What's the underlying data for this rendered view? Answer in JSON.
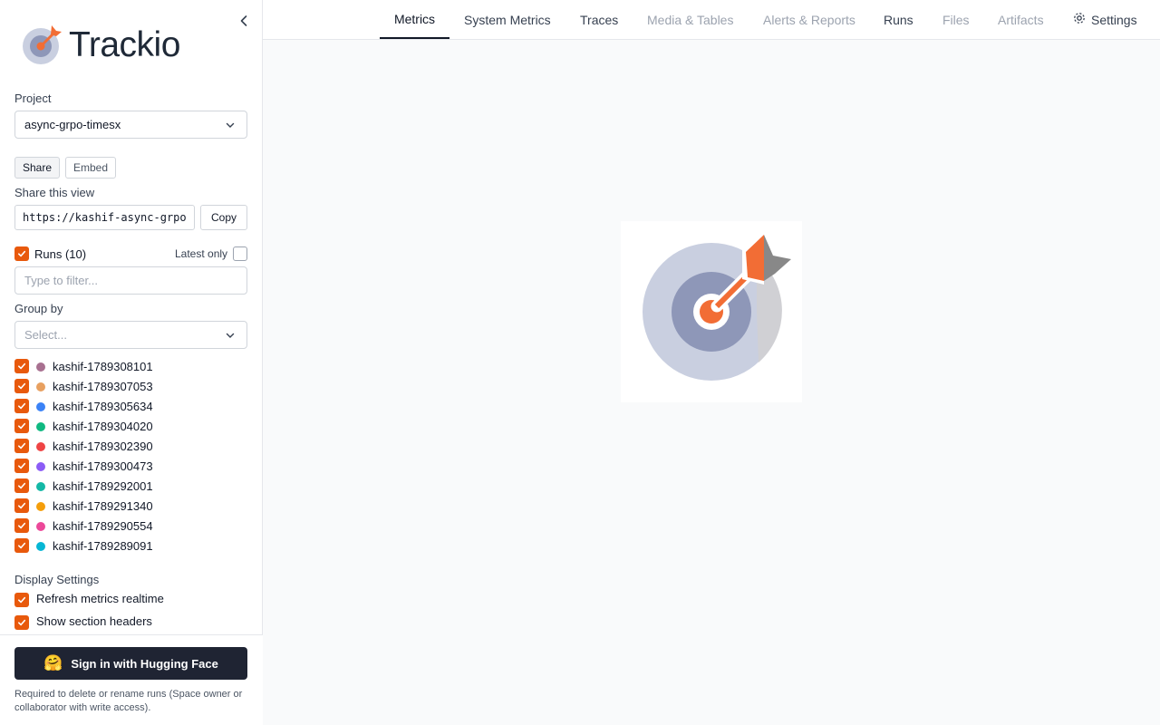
{
  "app": {
    "name": "Trackio"
  },
  "sidebar": {
    "project_label": "Project",
    "project_value": "async-grpo-timesx",
    "share_tabs": [
      "Share",
      "Embed"
    ],
    "share_view_label": "Share this view",
    "share_url": "https://kashif-async-grpo",
    "copy_label": "Copy",
    "runs_label": "Runs (10)",
    "latest_only_label": "Latest only",
    "filter_placeholder": "Type to filter...",
    "group_by_label": "Group by",
    "group_by_placeholder": "Select...",
    "runs": [
      {
        "name": "kashif-1789308101",
        "color": "#a87090"
      },
      {
        "name": "kashif-1789307053",
        "color": "#e8a060"
      },
      {
        "name": "kashif-1789305634",
        "color": "#3b82f6"
      },
      {
        "name": "kashif-1789304020",
        "color": "#10b981"
      },
      {
        "name": "kashif-1789302390",
        "color": "#ef4444"
      },
      {
        "name": "kashif-1789300473",
        "color": "#8b5cf6"
      },
      {
        "name": "kashif-1789292001",
        "color": "#14b8a6"
      },
      {
        "name": "kashif-1789291340",
        "color": "#f59e0b"
      },
      {
        "name": "kashif-1789290554",
        "color": "#ec4899"
      },
      {
        "name": "kashif-1789289091",
        "color": "#06b6d4"
      }
    ],
    "display_settings_label": "Display Settings",
    "settings": [
      {
        "label": "Refresh metrics realtime",
        "checked": true
      },
      {
        "label": "Show section headers",
        "checked": true
      }
    ],
    "signin_label": "Sign in with Hugging Face",
    "signin_note": "Required to delete or rename runs (Space owner or collaborator with write access)."
  },
  "nav": {
    "tabs": [
      {
        "label": "Metrics",
        "state": "active"
      },
      {
        "label": "System Metrics",
        "state": "enabled"
      },
      {
        "label": "Traces",
        "state": "enabled"
      },
      {
        "label": "Media & Tables",
        "state": "disabled"
      },
      {
        "label": "Alerts & Reports",
        "state": "disabled"
      },
      {
        "label": "Runs",
        "state": "enabled"
      },
      {
        "label": "Files",
        "state": "disabled"
      },
      {
        "label": "Artifacts",
        "state": "disabled"
      },
      {
        "label": "Settings",
        "state": "enabled"
      }
    ]
  },
  "colors": {
    "accent": "#e8590c",
    "brand_orange": "#f26d35",
    "target_ring": "#c9cfe0",
    "target_inner": "#8e97b8",
    "signin_bg": "#1f2433"
  }
}
